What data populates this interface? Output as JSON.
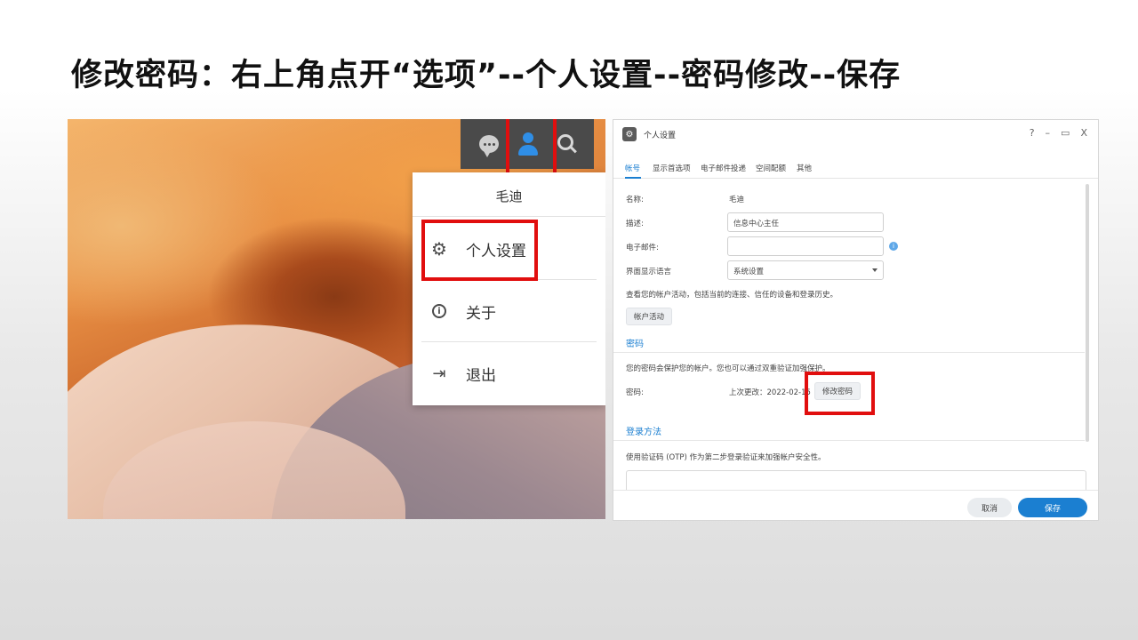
{
  "slide": {
    "title": "修改密码：右上角点开“选项”--个人设置--密码修改--保存"
  },
  "dsm_menu": {
    "topbar_icons": [
      "chat-icon",
      "user-icon",
      "search-icon"
    ],
    "user_name": "毛迪",
    "items": [
      {
        "label": "个人设置",
        "icon": "gear-icon"
      },
      {
        "label": "关于",
        "icon": "info-icon"
      },
      {
        "label": "退出",
        "icon": "logout-icon"
      }
    ],
    "highlight_color": "#e10e0e",
    "user_icon_color": "#2f8ee6"
  },
  "dialog": {
    "title": "个人设置",
    "controls": [
      "?",
      "–",
      "▭",
      "X"
    ],
    "tabs": [
      "帐号",
      "显示首选项",
      "电子邮件投递",
      "空间配额",
      "其他"
    ],
    "active_tab": "帐号",
    "fields": {
      "name_label": "名称:",
      "name_value": "毛迪",
      "desc_label": "描述:",
      "desc_value": "信息中心主任",
      "email_label": "电子邮件:",
      "email_value": "",
      "lang_label": "界面显示语言",
      "lang_value": "系统设置"
    },
    "activity_text": "查看您的帐户活动，包括当前的连接、信任的设备和登录历史。",
    "activity_button": "帐户活动",
    "password_section": "密码",
    "password_text": "您的密码会保护您的帐户。您也可以通过双重验证加强保护。",
    "password_label": "密码:",
    "password_last_changed": "上次更改：2022-02-15",
    "change_password_button": "修改密码",
    "login_section": "登录方法",
    "otp_text": "使用验证码 (OTP) 作为第二步登录验证来加强帐户安全性。",
    "cancel_button": "取消",
    "save_button": "保存",
    "accent_color": "#1b7fd1"
  }
}
